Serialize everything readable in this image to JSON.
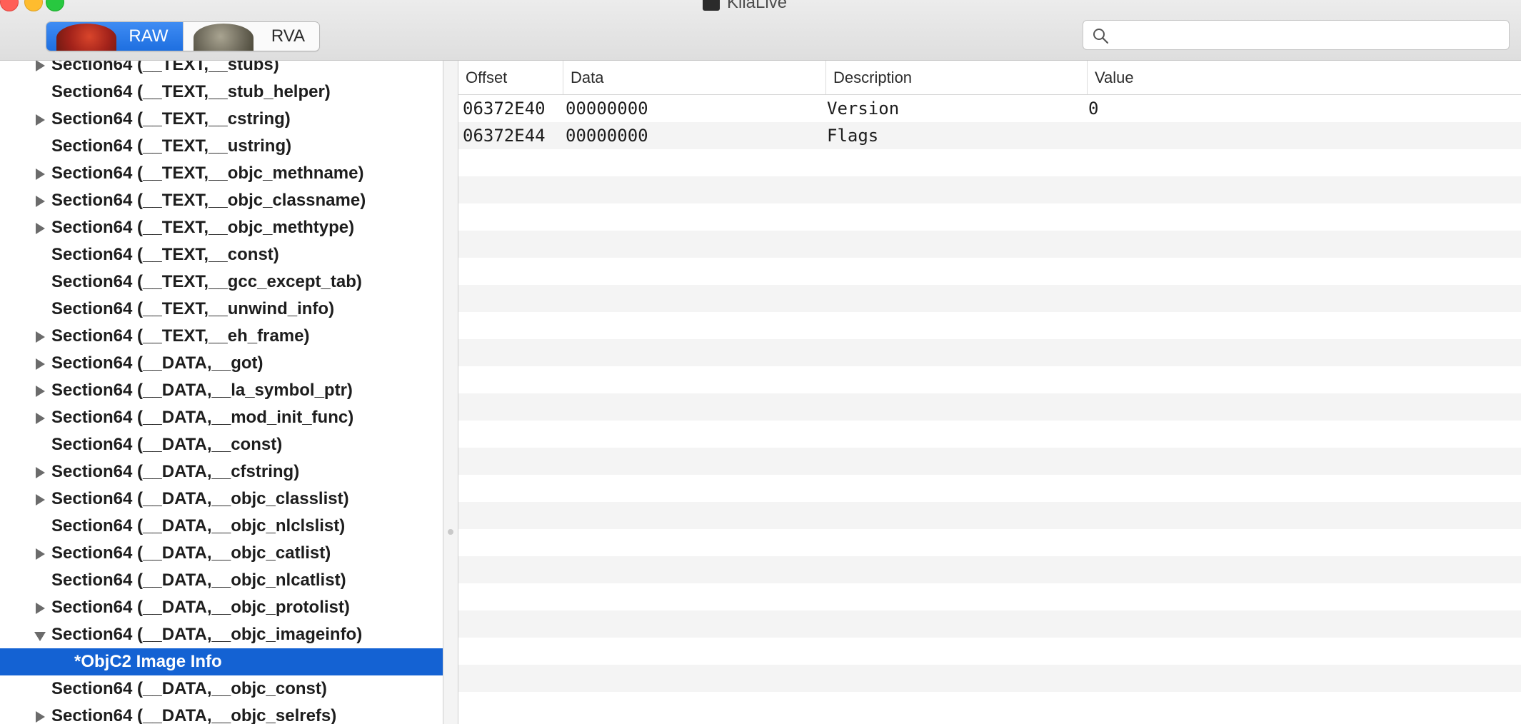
{
  "window": {
    "title": "KiiaLive"
  },
  "toolbar": {
    "segments": [
      {
        "label": "RAW",
        "active": true
      },
      {
        "label": "RVA",
        "active": false
      }
    ],
    "search": {
      "value": "",
      "placeholder": ""
    }
  },
  "sidebar": {
    "items": [
      {
        "label": "Section64 (__TEXT,__stubs)",
        "disclosure": "closed"
      },
      {
        "label": "Section64 (__TEXT,__stub_helper)",
        "disclosure": "none"
      },
      {
        "label": "Section64 (__TEXT,__cstring)",
        "disclosure": "closed"
      },
      {
        "label": "Section64 (__TEXT,__ustring)",
        "disclosure": "none"
      },
      {
        "label": "Section64 (__TEXT,__objc_methname)",
        "disclosure": "closed"
      },
      {
        "label": "Section64 (__TEXT,__objc_classname)",
        "disclosure": "closed"
      },
      {
        "label": "Section64 (__TEXT,__objc_methtype)",
        "disclosure": "closed"
      },
      {
        "label": "Section64 (__TEXT,__const)",
        "disclosure": "none"
      },
      {
        "label": "Section64 (__TEXT,__gcc_except_tab)",
        "disclosure": "none"
      },
      {
        "label": "Section64 (__TEXT,__unwind_info)",
        "disclosure": "none"
      },
      {
        "label": "Section64 (__TEXT,__eh_frame)",
        "disclosure": "closed"
      },
      {
        "label": "Section64 (__DATA,__got)",
        "disclosure": "closed"
      },
      {
        "label": "Section64 (__DATA,__la_symbol_ptr)",
        "disclosure": "closed"
      },
      {
        "label": "Section64 (__DATA,__mod_init_func)",
        "disclosure": "closed"
      },
      {
        "label": "Section64 (__DATA,__const)",
        "disclosure": "none"
      },
      {
        "label": "Section64 (__DATA,__cfstring)",
        "disclosure": "closed"
      },
      {
        "label": "Section64 (__DATA,__objc_classlist)",
        "disclosure": "closed"
      },
      {
        "label": "Section64 (__DATA,__objc_nlclslist)",
        "disclosure": "none"
      },
      {
        "label": "Section64 (__DATA,__objc_catlist)",
        "disclosure": "closed"
      },
      {
        "label": "Section64 (__DATA,__objc_nlcatlist)",
        "disclosure": "none"
      },
      {
        "label": "Section64 (__DATA,__objc_protolist)",
        "disclosure": "closed"
      },
      {
        "label": "Section64 (__DATA,__objc_imageinfo)",
        "disclosure": "open"
      },
      {
        "label": "*ObjC2 Image Info",
        "disclosure": "child",
        "selected": true
      },
      {
        "label": "Section64 (__DATA,__objc_const)",
        "disclosure": "none"
      },
      {
        "label": "Section64 (__DATA,__objc_selrefs)",
        "disclosure": "closed"
      }
    ]
  },
  "table": {
    "columns": [
      "Offset",
      "Data",
      "Description",
      "Value"
    ],
    "rows": [
      {
        "offset": "06372E40",
        "data": "00000000",
        "description": "Version",
        "value": "0"
      },
      {
        "offset": "06372E44",
        "data": "00000000",
        "description": "Flags",
        "value": ""
      }
    ]
  },
  "colors": {
    "selection": "#1462d3",
    "segment_active": "#1e6fe0",
    "row_alternate": "#f4f4f4"
  }
}
